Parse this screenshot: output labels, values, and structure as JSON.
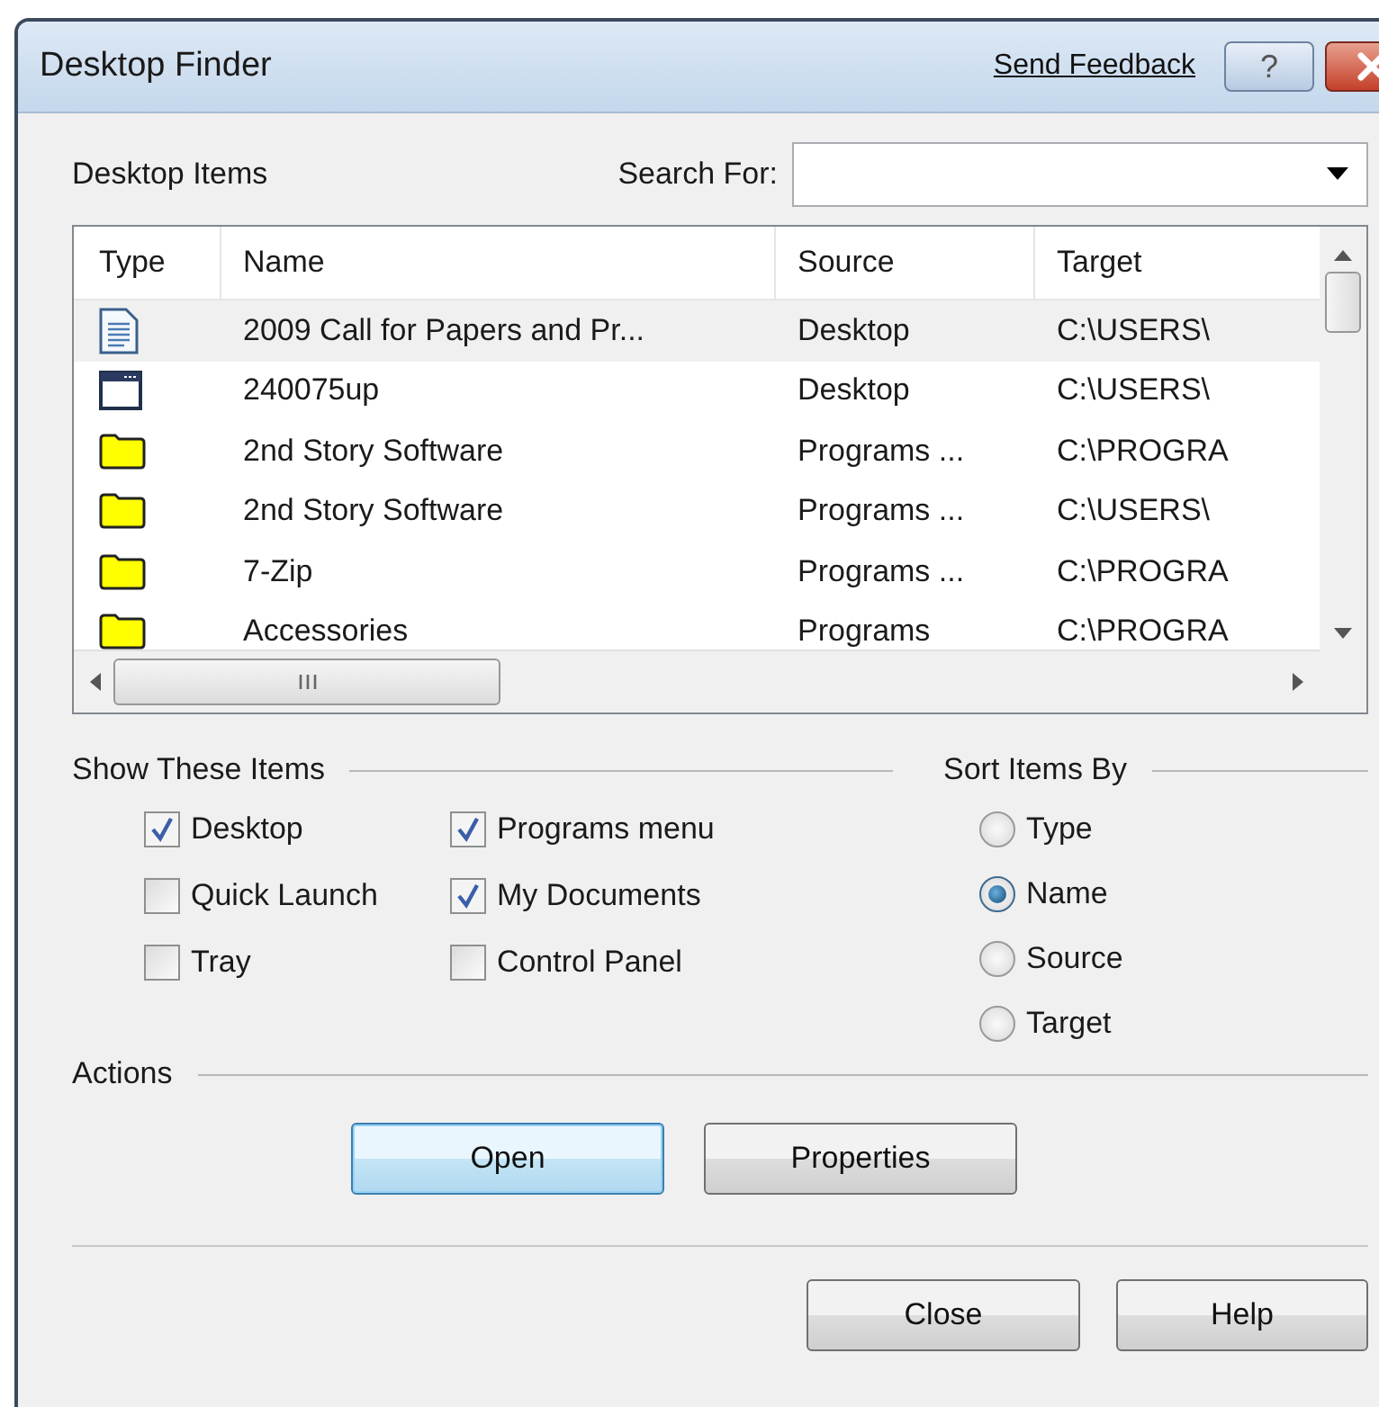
{
  "window": {
    "title": "Desktop Finder",
    "feedback_link": "Send Feedback",
    "help_button": "?"
  },
  "list_label": "Desktop Items",
  "search": {
    "label": "Search For:"
  },
  "table": {
    "columns": [
      "Type",
      "Name",
      "Source",
      "Target"
    ],
    "rows": [
      {
        "kind": "document",
        "name": "2009 Call for Papers and Pr...",
        "source": "Desktop",
        "target": "C:\\USERS\\",
        "selected": true
      },
      {
        "kind": "window",
        "name": "240075up",
        "source": "Desktop",
        "target": "C:\\USERS\\",
        "selected": false
      },
      {
        "kind": "folder",
        "name": "2nd Story Software",
        "source": "Programs ...",
        "target": "C:\\PROGRA",
        "selected": false
      },
      {
        "kind": "folder",
        "name": "2nd Story Software",
        "source": "Programs ...",
        "target": "C:\\USERS\\",
        "selected": false
      },
      {
        "kind": "folder",
        "name": "7-Zip",
        "source": "Programs ...",
        "target": "C:\\PROGRA",
        "selected": false
      },
      {
        "kind": "folder",
        "name": "Accessories",
        "source": "Programs",
        "target": "C:\\PROGRA",
        "selected": false
      }
    ]
  },
  "show_items": {
    "title": "Show These Items",
    "columns": [
      [
        {
          "label": "Desktop",
          "checked": true
        },
        {
          "label": "Quick Launch",
          "checked": false
        },
        {
          "label": "Tray",
          "checked": false
        }
      ],
      [
        {
          "label": "Programs menu",
          "checked": true
        },
        {
          "label": "My Documents",
          "checked": true
        },
        {
          "label": "Control Panel",
          "checked": false
        }
      ]
    ]
  },
  "sort": {
    "title": "Sort Items By",
    "options": [
      {
        "label": "Type",
        "selected": false
      },
      {
        "label": "Name",
        "selected": true
      },
      {
        "label": "Source",
        "selected": false
      },
      {
        "label": "Target",
        "selected": false
      }
    ]
  },
  "actions": {
    "title": "Actions",
    "buttons": [
      {
        "label": "Open",
        "default": true
      },
      {
        "label": "Properties",
        "default": false
      }
    ]
  },
  "footer_buttons": [
    "Close",
    "Help"
  ]
}
